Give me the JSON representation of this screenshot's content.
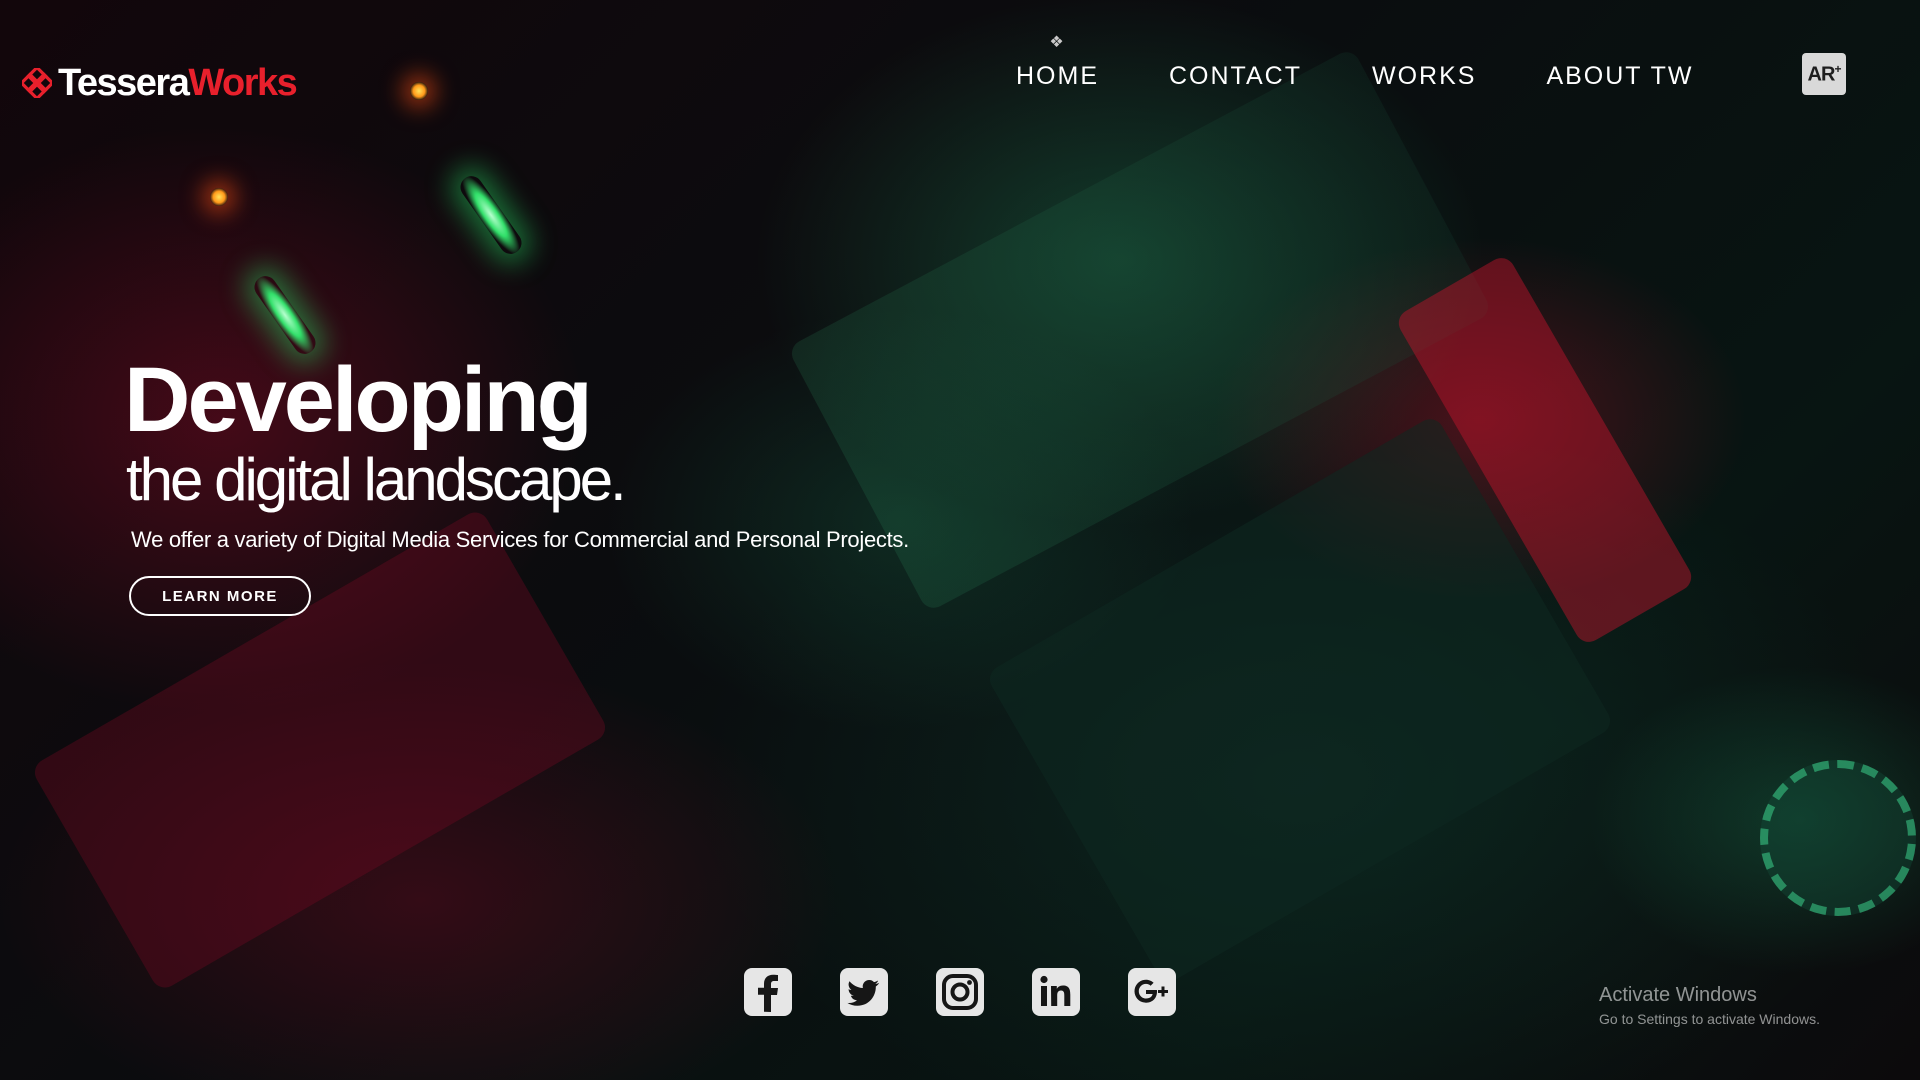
{
  "brand": {
    "name_part1": "Tessera",
    "name_part2": "Works",
    "accent_color": "#e8202c",
    "logo_icon": "tessera-knot-icon"
  },
  "nav": {
    "items": [
      {
        "label": "HOME",
        "active": true
      },
      {
        "label": "CONTACT",
        "active": false
      },
      {
        "label": "WORKS",
        "active": false
      },
      {
        "label": "ABOUT TW",
        "active": false
      }
    ],
    "active_marker_icon": "diamond-marker-icon"
  },
  "ar_badge": {
    "label": "AR",
    "sup": "+"
  },
  "hero": {
    "title": "Developing",
    "subtitle": "the digital landscape.",
    "description": "We offer a variety of Digital Media Services for Commercial and Personal Projects.",
    "cta_label": "LEARN MORE"
  },
  "social": {
    "icons": [
      "facebook-icon",
      "twitter-icon",
      "instagram-icon",
      "linkedin-icon",
      "google-plus-icon"
    ]
  },
  "watermark": {
    "title": "Activate Windows",
    "subtitle": "Go to Settings to activate Windows."
  }
}
